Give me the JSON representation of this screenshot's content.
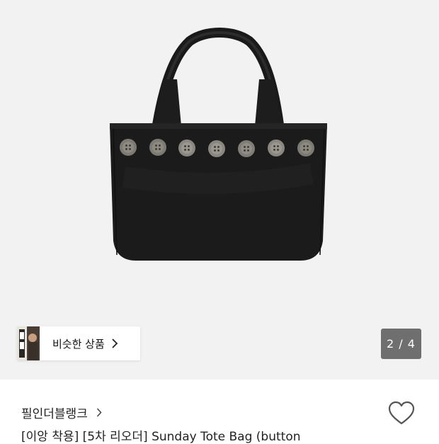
{
  "gallery": {
    "image_alt": "black leather tote bag with buttons",
    "similar_products_label": "비슷한 상품",
    "page_indicator": "2 / 4",
    "current_page": 2,
    "total_pages": 4
  },
  "product": {
    "brand": "필인더블랭크",
    "title": "[이앙 착용] [5차 리오더]  Sunday Tote Bag (button"
  },
  "icons": {
    "chip_chevron": "chevron-right-icon",
    "brand_chevron": "chevron-right-icon",
    "like": "heart-outline-icon"
  },
  "colors": {
    "gallery_background": "#f2f2f2",
    "indicator_background": "#6f6f6f",
    "bag": "#1c1c1c"
  }
}
